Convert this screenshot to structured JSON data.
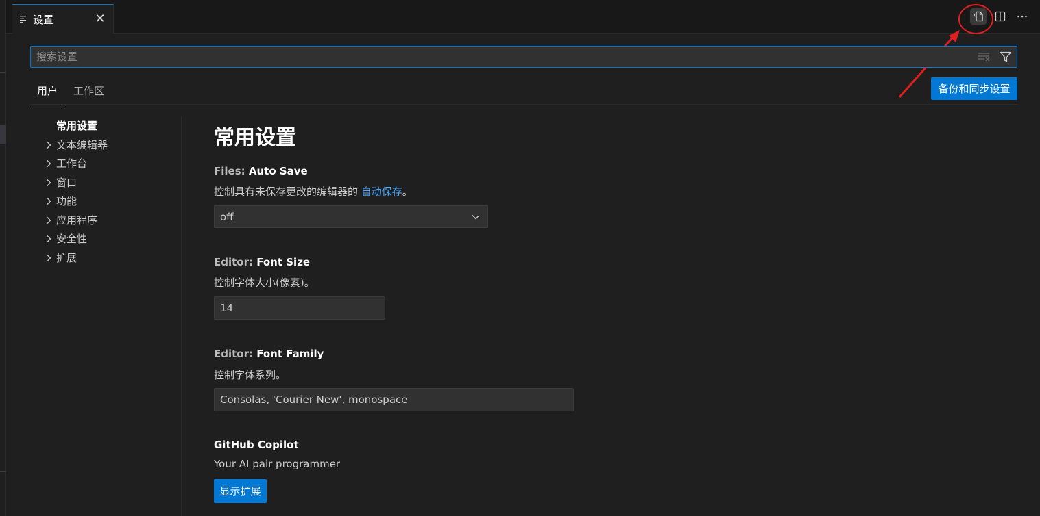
{
  "tab": {
    "label": "设置",
    "close": "✕"
  },
  "search": {
    "placeholder": "搜索设置"
  },
  "scope_tabs": {
    "user": "用户",
    "workspace": "工作区"
  },
  "sync_button": "备份和同步设置",
  "toc": {
    "active": "常用设置",
    "items": [
      "文本编辑器",
      "工作台",
      "窗口",
      "功能",
      "应用程序",
      "安全性",
      "扩展"
    ]
  },
  "page_title": "常用设置",
  "settings": {
    "auto_save": {
      "category": "Files: ",
      "name": "Auto Save",
      "desc_prefix": "控制具有未保存更改的编辑器的 ",
      "desc_link": "自动保存",
      "desc_suffix": "。",
      "value": "off"
    },
    "font_size": {
      "category": "Editor: ",
      "name": "Font Size",
      "desc": "控制字体大小(像素)。",
      "value": "14"
    },
    "font_family": {
      "category": "Editor: ",
      "name": "Font Family",
      "desc": "控制字体系列。",
      "value": "Consolas, 'Courier New', monospace"
    },
    "copilot": {
      "name": "GitHub Copilot",
      "desc": "Your AI pair programmer",
      "button": "显示扩展"
    }
  },
  "icons": {
    "tab": "settings-file-icon",
    "open_json": "open-settings-json-icon",
    "split": "split-editor-icon",
    "more": "more-actions-icon",
    "clear": "clear-filter-icon",
    "filter": "filter-icon"
  },
  "colors": {
    "accent": "#0078d4",
    "link": "#4daafc",
    "annotation": "#e02020"
  }
}
